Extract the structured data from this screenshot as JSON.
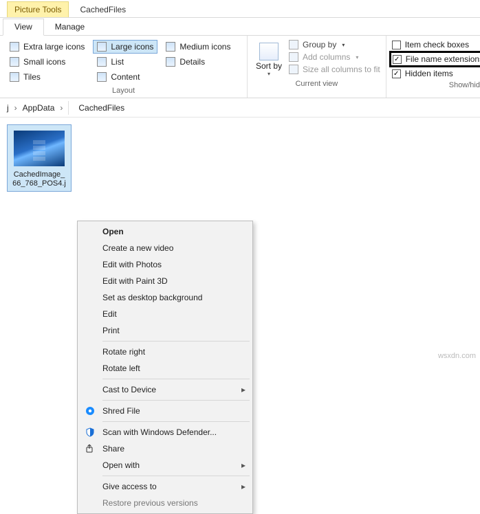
{
  "window": {
    "title": "CachedFiles"
  },
  "tabs": {
    "contextual_group": "Picture Tools",
    "view": "View",
    "manage": "Manage"
  },
  "ribbon": {
    "layout": {
      "title": "Layout",
      "extra_large": "Extra large icons",
      "large": "Large icons",
      "medium": "Medium icons",
      "small": "Small icons",
      "list": "List",
      "details": "Details",
      "tiles": "Tiles",
      "content": "Content"
    },
    "current_view": {
      "title": "Current view",
      "sort_by": "Sort by",
      "group_by": "Group by",
      "add_columns": "Add columns",
      "size_all": "Size all columns to fit"
    },
    "show_hide": {
      "title": "Show/hide",
      "item_checkboxes": "Item check boxes",
      "file_ext": "File name extensions",
      "hidden": "Hidden items"
    }
  },
  "breadcrumb": {
    "seg1": "j",
    "seg2": "AppData",
    "seg3": "CachedFiles"
  },
  "file": {
    "line1": "CachedImage_",
    "line2": "66_768_POS4.j"
  },
  "menu": {
    "open": "Open",
    "newvideo": "Create a new video",
    "photos": "Edit with Photos",
    "paint3d": "Edit with Paint 3D",
    "desktop_bg": "Set as desktop background",
    "edit": "Edit",
    "print": "Print",
    "rot_r": "Rotate right",
    "rot_l": "Rotate left",
    "cast": "Cast to Device",
    "shred": "Shred File",
    "defender": "Scan with Windows Defender...",
    "share": "Share",
    "openwith": "Open with",
    "giveaccess": "Give access to",
    "restore_prev": "Restore previous versions"
  }
}
